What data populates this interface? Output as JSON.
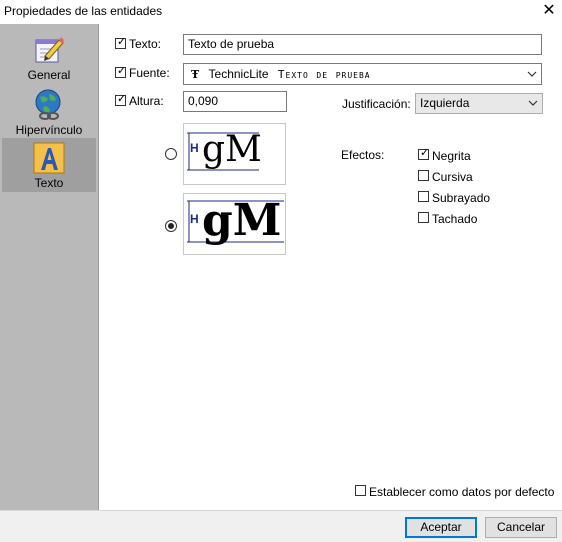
{
  "window": {
    "title": "Propiedades de las entidades"
  },
  "sidebar": {
    "items": [
      {
        "label": "General",
        "icon": "pencil-notepad-icon",
        "selected": false
      },
      {
        "label": "Hipervínculo",
        "icon": "globe-chain-icon",
        "selected": false
      },
      {
        "label": "Texto",
        "icon": "letter-a-icon",
        "selected": true
      }
    ]
  },
  "form": {
    "texto": {
      "label": "Texto:",
      "checked": true,
      "value": "Texto de prueba"
    },
    "fuente": {
      "label": "Fuente:",
      "checked": true,
      "font_name": "TechnicLite",
      "sample": "Texto de prueba"
    },
    "altura": {
      "label": "Altura:",
      "checked": true,
      "value": "0,090"
    },
    "justificacion": {
      "label": "Justificación:",
      "value": "Izquierda"
    },
    "preview": {
      "sample_glyphs": "gM",
      "height_marker": "H",
      "options": [
        {
          "selected": false
        },
        {
          "selected": true
        }
      ]
    },
    "efectos": {
      "label": "Efectos:",
      "items": [
        {
          "label": "Negrita",
          "checked": true
        },
        {
          "label": "Cursiva",
          "checked": false
        },
        {
          "label": "Subrayado",
          "checked": false
        },
        {
          "label": "Tachado",
          "checked": false
        }
      ]
    },
    "default_checkbox": {
      "label": "Establecer como datos por defecto",
      "checked": false
    }
  },
  "buttons": {
    "accept": "Aceptar",
    "cancel": "Cancelar"
  },
  "colors": {
    "sidebar": "#b9b9b9",
    "sidebar_selected": "#9f9f9f",
    "accent": "#0078d7",
    "guide_lines": "#1a2a8a"
  }
}
